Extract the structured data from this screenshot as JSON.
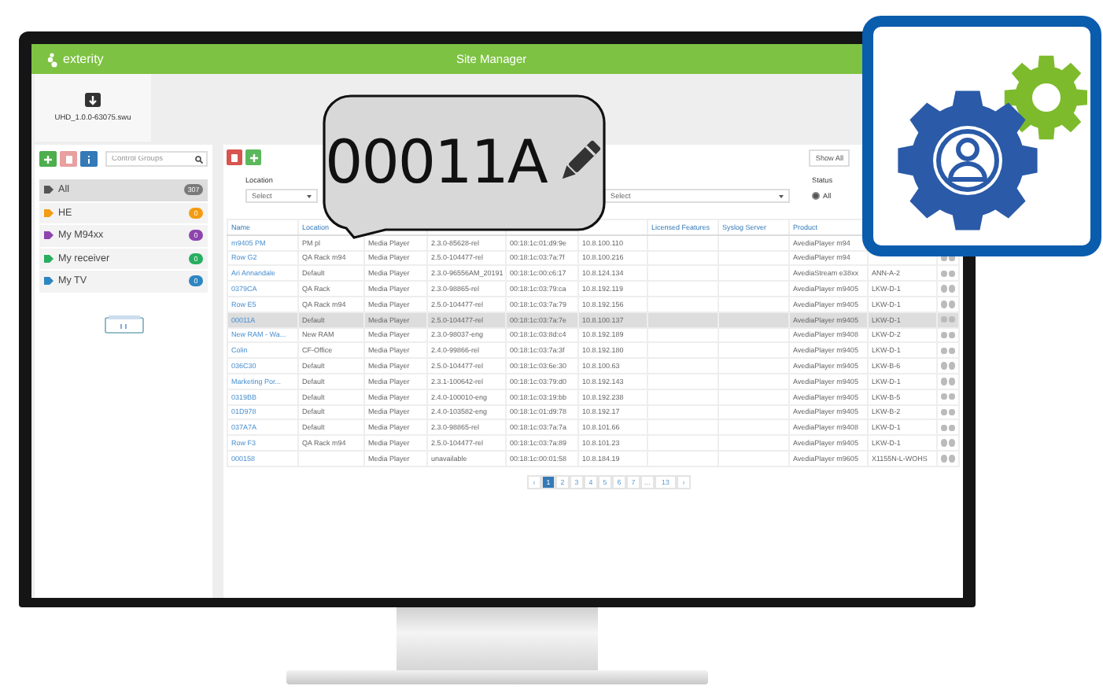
{
  "app_bar": {
    "logo": "exterity",
    "title": "Site Manager"
  },
  "firmware_tile": {
    "filename": "UHD_1.0.0-63075.swu"
  },
  "sidebar": {
    "search": {
      "placeholder": "Control Groups"
    },
    "groups": [
      {
        "label": "All",
        "count": "307",
        "color": "#7a7a7a",
        "selected": true
      },
      {
        "label": "HE",
        "count": "0",
        "color": "#f39c12",
        "selected": false
      },
      {
        "label": "My M94xx",
        "count": "0",
        "color": "#8e44ad",
        "selected": false
      },
      {
        "label": "My receiver",
        "count": "0",
        "color": "#27ae60",
        "selected": false
      },
      {
        "label": "My TV",
        "count": "0",
        "color": "#2e86c1",
        "selected": false
      }
    ]
  },
  "filters": {
    "location": {
      "label": "Location",
      "value": "Select"
    },
    "filter_2": {
      "value": "Select"
    },
    "status": {
      "label": "Status",
      "options": [
        {
          "label": "All",
          "selected": true
        }
      ]
    },
    "show_all_button": "Show All"
  },
  "table": {
    "headers": {
      "name": "Name",
      "location": "Location",
      "licensed": "Licensed Features",
      "syslog": "Syslog Server",
      "product": "Product"
    },
    "rows": [
      {
        "name": "m9405 PM",
        "location": "PM pl",
        "type": "Media Player",
        "version": "2.3.0-85628-rel",
        "mac": "00:18:1c:01:d9:9e",
        "ip": "10.8.100.110",
        "product": "AvediaPlayer m94",
        "selected": false
      },
      {
        "name": "Row G2",
        "location": "QA Rack m94",
        "type": "Media Player",
        "version": "2.5.0-104477-rel",
        "mac": "00:18:1c:03:7a:7f",
        "ip": "10.8.100.216",
        "product": "AvediaPlayer m94",
        "selected": false
      },
      {
        "name": "Ari Annandale",
        "location": "Default",
        "type": "Media Player",
        "version": "2.3.0-96556AM_20191",
        "mac": "00:18:1c:00:c6:17",
        "ip": "10.8.124.134",
        "product": "AvediaStream e38xx",
        "column_10": "ANN-A-2",
        "selected": false
      },
      {
        "name": "0379CA",
        "location": "QA Rack",
        "type": "Media Player",
        "version": "2.3.0-98865-rel",
        "mac": "00:18:1c:03:79:ca",
        "ip": "10.8.192.119",
        "product": "AvediaPlayer m9405",
        "column_10": "LKW-D-1",
        "selected": false
      },
      {
        "name": "Row E5",
        "location": "QA Rack m94",
        "type": "Media Player",
        "version": "2.5.0-104477-rel",
        "mac": "00:18:1c:03:7a:79",
        "ip": "10.8.192.156",
        "product": "AvediaPlayer m9405",
        "column_10": "LKW-D-1",
        "selected": false
      },
      {
        "name": "00011A",
        "location": "Default",
        "type": "Media Player",
        "version": "2.5.0-104477-rel",
        "mac": "00:18:1c:03:7a:7e",
        "ip": "10.8.100.137",
        "product": "AvediaPlayer m9405",
        "column_10": "LKW-D-1",
        "selected": true
      },
      {
        "name": "New RAM - Wa...",
        "location": "New RAM",
        "type": "Media Player",
        "version": "2.3.0-98037-eng",
        "mac": "00:18:1c:03:8d:c4",
        "ip": "10.8.192.189",
        "product": "AvediaPlayer m9408",
        "column_10": "LKW-D-2",
        "selected": false
      },
      {
        "name": "Colin",
        "location": "CF-Office",
        "type": "Media Player",
        "version": "2.4.0-99866-rel",
        "mac": "00:18:1c:03:7a:3f",
        "ip": "10.8.192.180",
        "product": "AvediaPlayer m9405",
        "column_10": "LKW-D-1",
        "selected": false
      },
      {
        "name": "036C30",
        "location": "Default",
        "type": "Media Player",
        "version": "2.5.0-104477-rel",
        "mac": "00:18:1c:03:6e:30",
        "ip": "10.8.100.63",
        "product": "AvediaPlayer m9405",
        "column_10": "LKW-B-6",
        "selected": false
      },
      {
        "name": "Marketing Por...",
        "location": "Default",
        "type": "Media Player",
        "version": "2.3.1-100642-rel",
        "mac": "00:18:1c:03:79:d0",
        "ip": "10.8.192.143",
        "product": "AvediaPlayer m9405",
        "column_10": "LKW-D-1",
        "selected": false
      },
      {
        "name": "0319BB",
        "location": "Default",
        "type": "Media Player",
        "version": "2.4.0-100010-eng",
        "mac": "00:18:1c:03:19:bb",
        "ip": "10.8.192.238",
        "product": "AvediaPlayer m9405",
        "column_10": "LKW-B-5",
        "selected": false
      },
      {
        "name": "01D978",
        "location": "Default",
        "type": "Media Player",
        "version": "2.4.0-103582-eng",
        "mac": "00:18:1c:01:d9:78",
        "ip": "10.8.192.17",
        "product": "AvediaPlayer m9405",
        "column_10": "LKW-B-2",
        "selected": false
      },
      {
        "name": "037A7A",
        "location": "Default",
        "type": "Media Player",
        "version": "2.3.0-98865-rel",
        "mac": "00:18:1c:03:7a:7a",
        "ip": "10.8.101.66",
        "product": "AvediaPlayer m9408",
        "column_10": "LKW-D-1",
        "selected": false
      },
      {
        "name": "Row F3",
        "location": "QA Rack m94",
        "type": "Media Player",
        "version": "2.5.0-104477-rel",
        "mac": "00:18:1c:03:7a:89",
        "ip": "10.8.101.23",
        "product": "AvediaPlayer m9405",
        "column_10": "LKW-D-1",
        "selected": false
      },
      {
        "name": "000158",
        "type": "Media Player",
        "version": "unavailable",
        "mac": "00:18:1c:00:01:58",
        "ip": "10.8.184.19",
        "product": "AvediaPlayer m9605",
        "column_10": "X1155N-L-WOHS",
        "selected": false
      }
    ]
  },
  "pagination": [
    {
      "label": "‹",
      "selected": false
    },
    {
      "label": "1",
      "selected": true
    },
    {
      "label": "2",
      "selected": false
    },
    {
      "label": "3",
      "selected": false
    },
    {
      "label": "4",
      "selected": false
    },
    {
      "label": "5",
      "selected": false
    },
    {
      "label": "6",
      "selected": false
    },
    {
      "label": "7",
      "selected": false
    },
    {
      "label": "…",
      "selected": false
    },
    {
      "label": "13",
      "selected": false
    },
    {
      "label": "›",
      "selected": false
    }
  ],
  "callout": {
    "text": "00011A"
  }
}
